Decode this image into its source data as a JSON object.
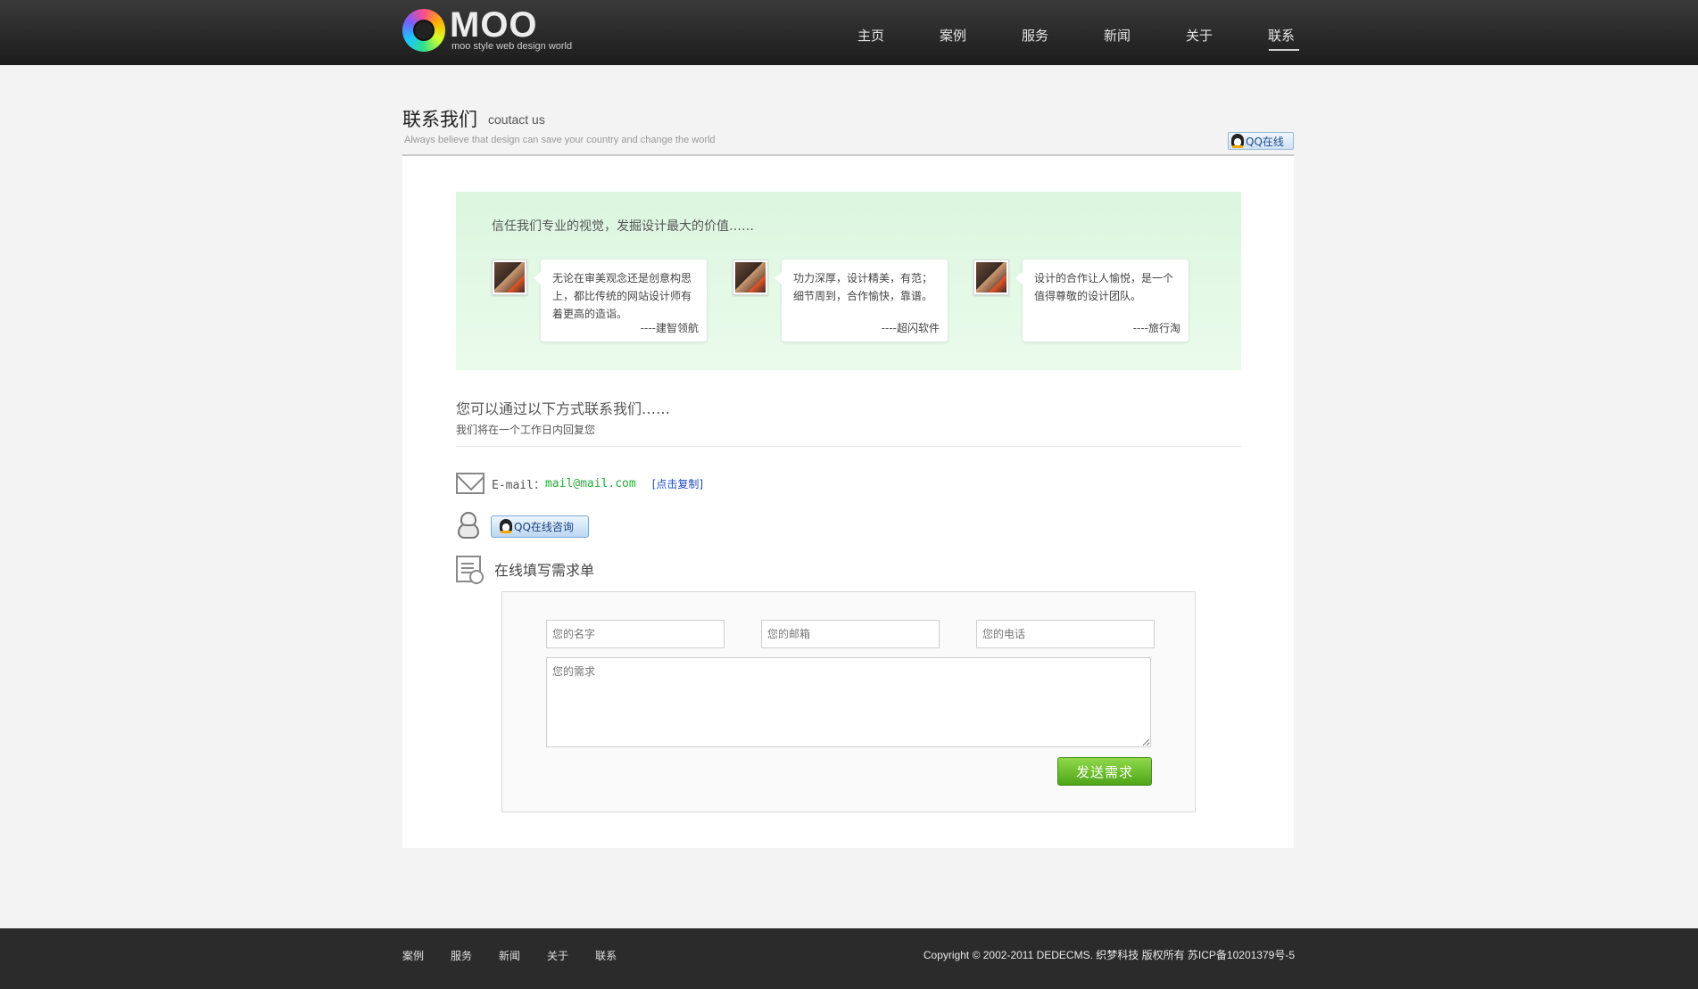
{
  "header": {
    "logo_title": "MOO",
    "logo_sub": "moo style web design world",
    "nav": [
      "主页",
      "案例",
      "服务",
      "新闻",
      "关于",
      "联系"
    ],
    "active_nav": "联系"
  },
  "page": {
    "title": "联系我们",
    "title_en": "coutact us",
    "slogan": "Always believe that design can save your country and change the world",
    "qq_online": "QQ在线"
  },
  "trust": {
    "title": "信任我们专业的视觉，发掘设计最大的价值……",
    "testimonials": [
      {
        "text": "无论在审美观念还是创意构思上，都比传统的网站设计师有着更高的造诣。",
        "author": "----建智领航"
      },
      {
        "text": "功力深厚，设计精美，有范；细节周到，合作愉快，靠谱。",
        "author": "----超闪软件"
      },
      {
        "text": "设计的合作让人愉悦，是一个值得尊敬的设计团队。",
        "author": "----旅行淘"
      }
    ]
  },
  "contact": {
    "title": "您可以通过以下方式联系我们……",
    "subtitle": "我们将在一个工作日内回复您",
    "email_label": "E-mail：",
    "email": "mail@mail.com",
    "copy_link": "[点击复制]",
    "qq_consult": "QQ在线咨询",
    "form_title": "在线填写需求单"
  },
  "form": {
    "name_placeholder": "您的名字",
    "email_placeholder": "您的邮箱",
    "phone_placeholder": "您的电话",
    "need_placeholder": "您的需求",
    "submit": "发送需求"
  },
  "footer": {
    "links": [
      "案例",
      "服务",
      "新闻",
      "关于",
      "联系"
    ],
    "copyright": "Copyright © 2002-2011 DEDECMS. 织梦科技 版权所有 苏ICP备10201379号-5"
  },
  "colors": {
    "header_bg": "#2a2a2a",
    "trust_bg": "#e3f8e6",
    "email_green": "#2ba83b",
    "link_blue": "#1f49c8",
    "submit_green": "#5cb021"
  }
}
